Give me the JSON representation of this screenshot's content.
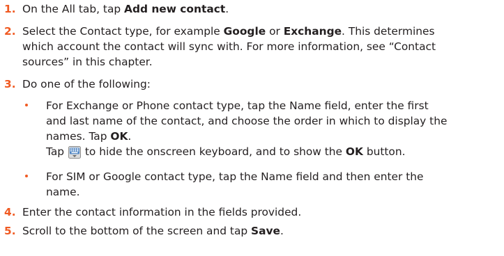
{
  "steps": [
    {
      "number": "1.",
      "pre": "On the All tab, tap ",
      "bold": "Add new contact",
      "post": "."
    },
    {
      "number": "2.",
      "pre": "Select the Contact type, for example ",
      "bold1": "Google",
      "mid": " or ",
      "bold2": "Exchange",
      "post": ". This determines",
      "line2": "which account the contact will sync with. For more information, see “Contact",
      "line3": "sources” in this chapter."
    },
    {
      "number": "3.",
      "text": "Do one of the following:"
    },
    {
      "number": "4.",
      "text": "Enter the contact information in the fields provided."
    },
    {
      "number": "5.",
      "pre": "Scroll to the bottom of the screen and tap ",
      "bold": "Save",
      "post": "."
    }
  ],
  "bullets": [
    {
      "line1": "For Exchange or Phone contact type, tap the Name field, enter the first",
      "line2": "and last name of the contact, and choose the order in which to display the",
      "line3_pre": "names. Tap ",
      "line3_bold": "OK",
      "line3_post": ".",
      "line4_pre": "Tap ",
      "icon": "keyboard-icon",
      "line4_mid": " to hide the onscreen keyboard, and to show the ",
      "line4_bold": "OK",
      "line4_post": " button."
    },
    {
      "line1": "For SIM or Google contact type, tap the Name field and then enter the",
      "line2": "name."
    }
  ],
  "colors": {
    "accent": "#f05a22",
    "text": "#231f20",
    "icon_blue": "#4d84c4"
  }
}
